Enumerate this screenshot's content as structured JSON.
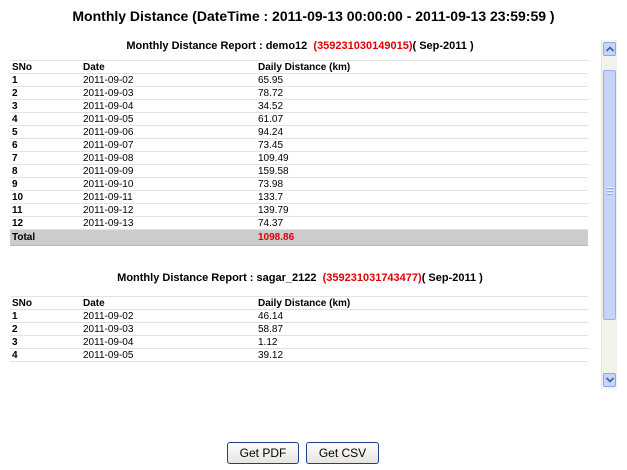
{
  "page_title": "Monthly Distance (DateTime : 2011-09-13 00:00:00 - 2011-09-13 23:59:59 )",
  "columns": {
    "sno": "SNo",
    "date": "Date",
    "distance": "Daily Distance (km)"
  },
  "reports": [
    {
      "heading_prefix": "Monthly Distance Report : demo12",
      "imei": "(359231030149015)",
      "period": "( Sep-2011 )",
      "rows": [
        {
          "sno": "1",
          "date": "2011-09-02",
          "distance": "65.95"
        },
        {
          "sno": "2",
          "date": "2011-09-03",
          "distance": "78.72"
        },
        {
          "sno": "3",
          "date": "2011-09-04",
          "distance": "34.52"
        },
        {
          "sno": "4",
          "date": "2011-09-05",
          "distance": "61.07"
        },
        {
          "sno": "5",
          "date": "2011-09-06",
          "distance": "94.24"
        },
        {
          "sno": "6",
          "date": "2011-09-07",
          "distance": "73.45"
        },
        {
          "sno": "7",
          "date": "2011-09-08",
          "distance": "109.49"
        },
        {
          "sno": "8",
          "date": "2011-09-09",
          "distance": "159.58"
        },
        {
          "sno": "9",
          "date": "2011-09-10",
          "distance": "73.98"
        },
        {
          "sno": "10",
          "date": "2011-09-11",
          "distance": "133.7"
        },
        {
          "sno": "11",
          "date": "2011-09-12",
          "distance": "139.79"
        },
        {
          "sno": "12",
          "date": "2011-09-13",
          "distance": "74.37"
        }
      ],
      "total_label": "Total",
      "total_value": "1098.86"
    },
    {
      "heading_prefix": "Monthly Distance Report : sagar_2122",
      "imei": "(359231031743477)",
      "period": "( Sep-2011 )",
      "rows": [
        {
          "sno": "1",
          "date": "2011-09-02",
          "distance": "46.14"
        },
        {
          "sno": "2",
          "date": "2011-09-03",
          "distance": "58.87"
        },
        {
          "sno": "3",
          "date": "2011-09-04",
          "distance": "1.12"
        },
        {
          "sno": "4",
          "date": "2011-09-05",
          "distance": "39.12"
        }
      ]
    }
  ],
  "buttons": {
    "pdf": "Get PDF",
    "csv": "Get CSV"
  }
}
